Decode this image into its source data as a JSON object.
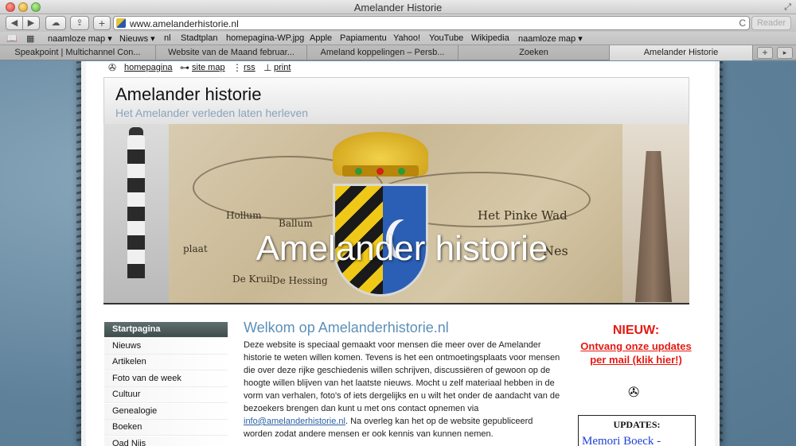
{
  "window": {
    "title": "Amelander Historie"
  },
  "toolbar": {
    "back": "◀",
    "forward": "▶",
    "cloud": "☁",
    "share": "⇪",
    "add": "+",
    "url": "www.amelanderhistorie.nl",
    "reload": "C",
    "reader": "Reader"
  },
  "bookmarks": {
    "items": [
      "naamloze map ▾",
      "Nieuws ▾",
      "nl",
      "Stadtplan",
      "homepagina-WP.jpg",
      "Apple",
      "Papiamentu",
      "Yahoo!",
      "YouTube",
      "Wikipedia",
      "naamloze map ▾"
    ]
  },
  "tabs": {
    "items": [
      "Speakpoint | Multichannel Con...",
      "Website van de Maand februar...",
      "Ameland koppelingen – Persb...",
      "Zoeken",
      "Amelander Historie"
    ],
    "active_index": 4
  },
  "topnav": {
    "home": "homepagina",
    "sitemap": "site map",
    "rss": "rss",
    "print": "print"
  },
  "header": {
    "title": "Amelander historie",
    "subtitle": "Het Amelander verleden laten herleven"
  },
  "banner": {
    "title": "Amelander historie",
    "map_labels": [
      "Hollum",
      "Ballum",
      "Het Pinke Wad",
      "plaat",
      "De Kruil",
      "De Hessing",
      "Nes"
    ]
  },
  "menu": {
    "items": [
      "Startpagina",
      "Nieuws",
      "Artikelen",
      "Foto van de week",
      "Cultuur",
      "Genealogie",
      "Boeken",
      "Oad Nijs"
    ]
  },
  "main": {
    "heading": "Welkom op Amelanderhistorie.nl",
    "para_1": "Deze website is speciaal gemaakt voor mensen die meer over de Amelander historie te weten willen komen. Tevens is het een ontmoetingsplaats voor mensen die over deze rijke geschiedenis willen schrijven, discussiëren of gewoon op de hoogte willen blijven van het laatste nieuws. Mocht u zelf materiaal hebben in de vorm van verhalen, foto's of iets dergelijks en u wilt het onder de aandacht van de bezoekers brengen dan kunt u met ons contact opnemen via",
    "email": "info@amelanderhistorie.nl",
    "para_2": ". Na overleg kan het op de website gepubliceerd worden zodat andere mensen er ook kennis van kunnen nemen."
  },
  "sidebar_right": {
    "nieuw": "NIEUW:",
    "link": "Ontvang onze updates per mail (klik hier!)",
    "updates_title": "UPDATES:",
    "updates_item": "Memori Boeck -"
  },
  "colors": {
    "accent_blue": "#5c8fb8",
    "news_red": "#e41a12",
    "menu_active": "#4a5a59",
    "link_blue": "#1b3fd6"
  }
}
